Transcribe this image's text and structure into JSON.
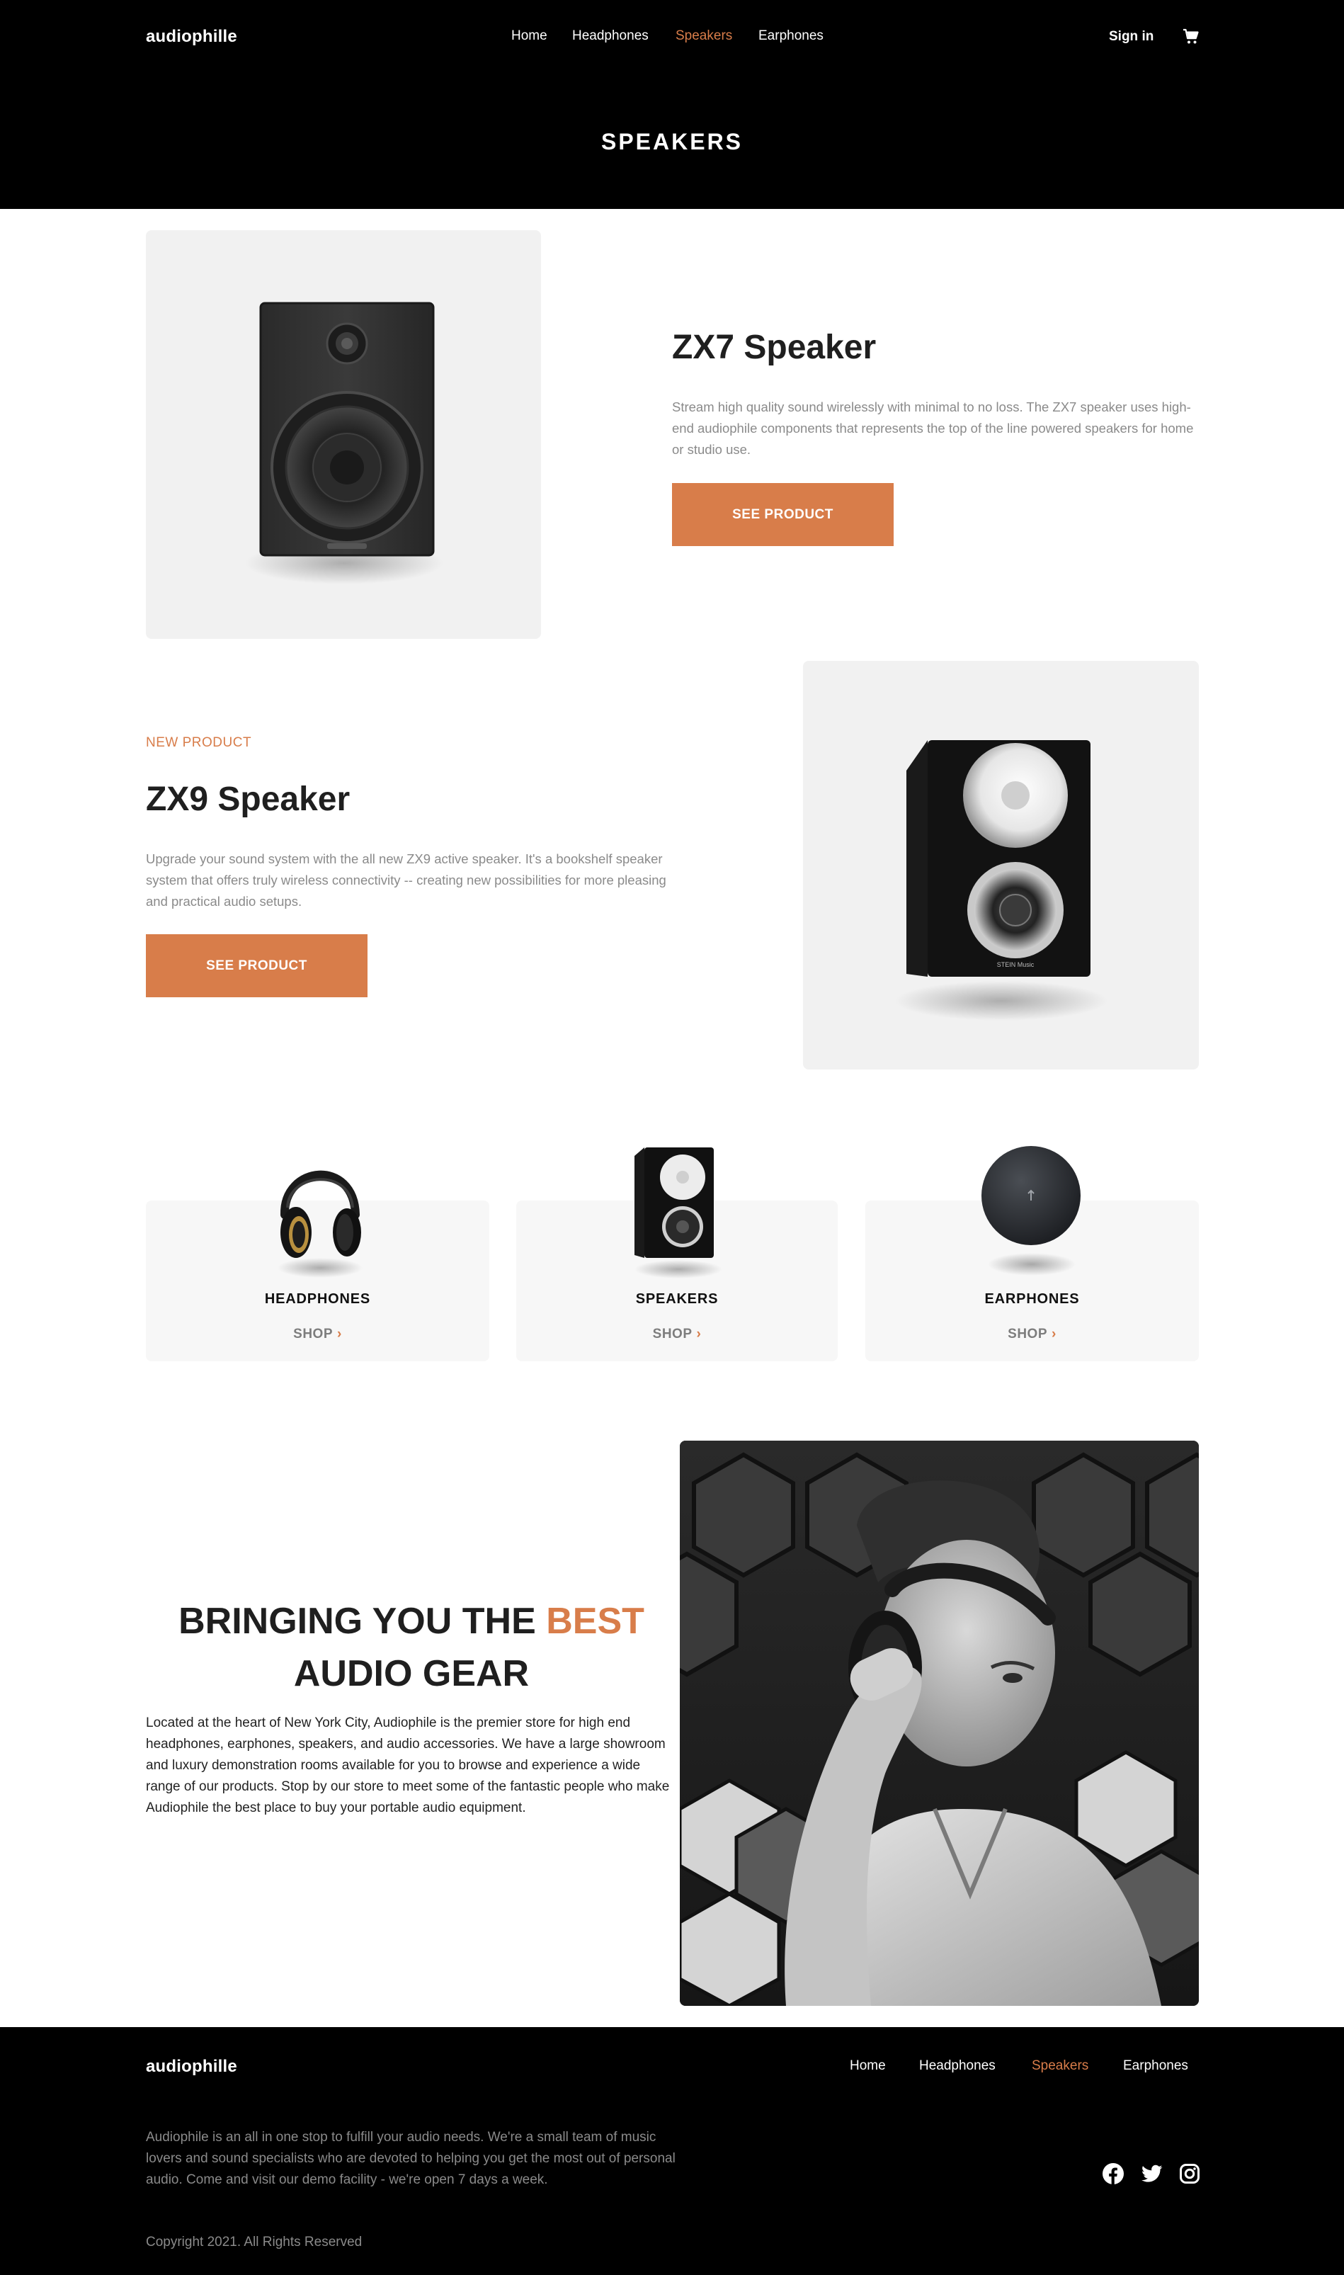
{
  "header": {
    "brand": "audiophille",
    "nav": [
      "Home",
      "Headphones",
      "Speakers",
      "Earphones"
    ],
    "active_nav": "Speakers",
    "sign_in": "Sign in",
    "page_title": "SPEAKERS"
  },
  "products": [
    {
      "eyebrow": "",
      "title": "ZX7 Speaker",
      "description": "Stream high quality sound wirelessly with minimal to no loss. The ZX7 speaker uses high-end audiophile components that represents the top of the line powered speakers for home or studio use.",
      "button": "SEE PRODUCT"
    },
    {
      "eyebrow": "NEW PRODUCT",
      "title": "ZX9 Speaker",
      "description": "Upgrade your sound system with the all new ZX9 active speaker. It's a bookshelf speaker system that offers truly wireless connectivity -- creating new possibilities for more pleasing and practical audio setups.",
      "button": "SEE PRODUCT"
    }
  ],
  "categories": [
    {
      "title": "HEADPHONES",
      "shop": "SHOP"
    },
    {
      "title": "SPEAKERS",
      "shop": "SHOP"
    },
    {
      "title": "EARPHONES",
      "shop": "SHOP"
    }
  ],
  "about": {
    "heading_before": "BRINGING YOU THE ",
    "heading_accent": "BEST",
    "heading_after": "AUDIO GEAR",
    "text": "Located at the heart of New York City, Audiophile is the premier store for high end headphones, earphones, speakers, and audio accessories. We have a large showroom and luxury demonstration rooms available for you to browse and experience a wide range of our products. Stop by our store to meet some of the fantastic people who make Audiophile the best place to buy your portable audio equipment."
  },
  "footer": {
    "brand": "audiophille",
    "nav": [
      "Home",
      "Headphones",
      "Speakers",
      "Earphones"
    ],
    "description": "Audiophile is an all in one stop to fulfill your audio needs. We're a small team of music lovers and sound specialists who are devoted to helping you get the most out of personal audio. Come and visit our demo facility - we're open 7 days a week.",
    "copyright": "Copyright 2021. All Rights Reserved",
    "social_icons": [
      "facebook-icon",
      "twitter-icon",
      "instagram-icon"
    ]
  },
  "colors": {
    "accent": "#d87d4a",
    "dark": "#000000",
    "card": "#f1f1f1"
  },
  "speaker_brand_mark": "STEIN Music"
}
